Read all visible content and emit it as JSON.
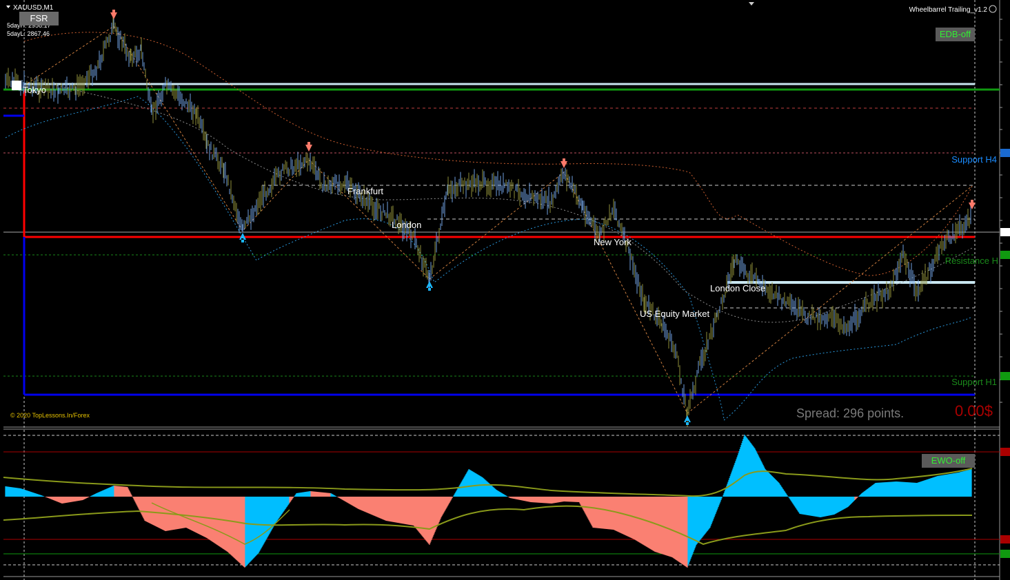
{
  "header": {
    "symbol_label": "XAUUSD,M1",
    "five_day_high": "5dayH: 2956.17",
    "five_day_low": "5dayL: 2867.46",
    "indicator_name": "Wheelbarrel Trailing_v1.2"
  },
  "buttons": {
    "fsr": "FSR",
    "edb": "EDB-off",
    "ewo": "EWO-off"
  },
  "sessions": {
    "tokyo": "Tokyo",
    "frankfurt": "Frankfurt",
    "london": "London",
    "new_york": "New York",
    "london_close": "London Close",
    "us_equity": "US Equity Market"
  },
  "levels": {
    "support_h4": "Support H4",
    "resistance_h1": "Resistance H",
    "support_h1": "Support H1"
  },
  "footer": {
    "copyright": "© 2020 TopLessons.In/Forex",
    "spread": "Spread: 296 points.",
    "profit": "0.00$"
  },
  "colors": {
    "background": "#000000",
    "candle": "#8f8f3a",
    "candle_wick": "#6fa0e0",
    "sell_arrow": "#ff7a6a",
    "buy_arrow": "#1ab8ff",
    "ewo_positive": "#00bfff",
    "ewo_negative": "#fa8072",
    "red_level": "#ff0000",
    "green_level": "#109a10",
    "blue_level": "#0000ee"
  },
  "chart_data": [
    {
      "type": "line",
      "title": "",
      "series": [
        {
          "x": [
            8,
            35,
            60,
            85,
            110,
            140,
            165,
            190,
            205,
            220,
            240,
            260,
            285,
            300,
            325,
            352,
            380,
            410,
            448,
            470,
            500,
            540,
            570,
            600,
            623,
            650,
            690,
            730,
            770,
            800,
            818,
            845,
            870,
            890,
            910,
            935,
            960,
            980,
            997,
            1015,
            1040,
            1065,
            1100,
            1140,
            1170,
            1200,
            1230,
            1260,
            1290,
            1310,
            1330,
            1350,
            1370,
            1390,
            1410
          ],
          "y": [
            118,
            124,
            128,
            132,
            130,
            100,
            38,
            85,
            72,
            165,
            125,
            140,
            165,
            210,
            245,
            335,
            285,
            248,
            232,
            270,
            265,
            300,
            315,
            345,
            405,
            275,
            265,
            270,
            285,
            295,
            250,
            300,
            345,
            300,
            360,
            440,
            470,
            510,
            600,
            530,
            460,
            380,
            410,
            440,
            460,
            460,
            475,
            440,
            420,
            370,
            425,
            390,
            350,
            335,
            315
          ]
        }
      ],
      "ylim": [
        0,
        630
      ]
    },
    {
      "type": "area",
      "title": "",
      "series": [
        {
          "x": [
            8,
            30,
            60,
            90,
            120,
            140,
            165,
            185,
            210,
            240,
            270,
            300,
            330,
            355,
            375,
            400,
            430,
            450,
            480,
            520,
            560,
            600,
            623,
            640,
            660,
            680,
            700,
            720,
            740,
            770,
            800,
            818,
            840,
            860,
            890,
            920,
            950,
            975,
            997,
            1010,
            1030,
            1050,
            1070,
            1080,
            1095,
            1110,
            1130,
            1160,
            1190,
            1210,
            1230,
            1250,
            1270,
            1300,
            1330,
            1360,
            1390,
            1410
          ],
          "y": [
            15,
            12,
            2,
            -10,
            -5,
            5,
            16,
            14,
            -35,
            -50,
            -45,
            -60,
            -80,
            -103,
            -82,
            -38,
            5,
            8,
            5,
            -18,
            -35,
            -42,
            -70,
            -30,
            5,
            40,
            28,
            10,
            -2,
            -8,
            -10,
            -7,
            -8,
            -45,
            -48,
            -62,
            -80,
            -88,
            -103,
            -70,
            -45,
            5,
            60,
            90,
            70,
            40,
            20,
            -25,
            -30,
            -26,
            -15,
            5,
            20,
            22,
            20,
            30,
            35,
            40
          ]
        }
      ],
      "ylim": [
        -105,
        90
      ]
    }
  ]
}
